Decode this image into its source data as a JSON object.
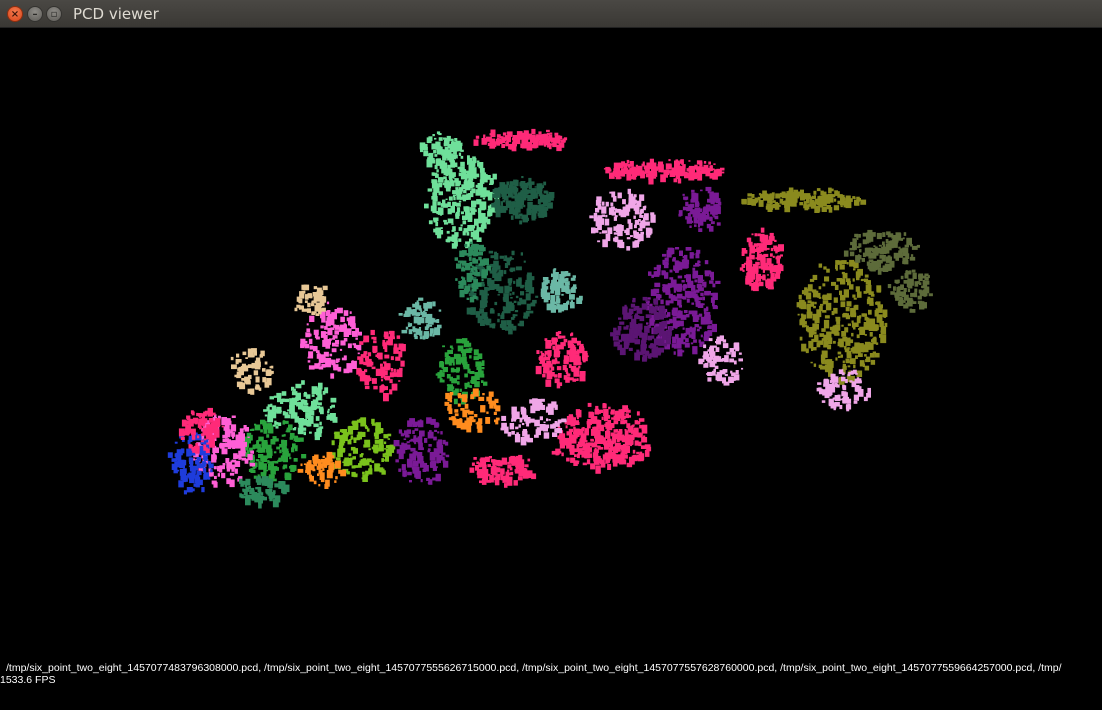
{
  "window": {
    "title": "PCD viewer",
    "close_glyph": "×",
    "minimize_glyph": "–",
    "maximize_glyph": "▫"
  },
  "viewer": {
    "loaded_files": "/tmp/six_point_two_eight_1457077483796308000.pcd, /tmp/six_point_two_eight_1457077555626715000.pcd, /tmp/six_point_two_eight_1457077557628760000.pcd, /tmp/six_point_two_eight_1457077559664257000.pcd, /tmp/",
    "fps_label": "1533.6 FPS",
    "background_color": "#000000",
    "cluster_colors": [
      "#6fe09a",
      "#1f5e46",
      "#2c8a5c",
      "#7a1a96",
      "#5b1573",
      "#ff2a78",
      "#f0a6e8",
      "#8a8a1e",
      "#5d6b3a",
      "#e8c896",
      "#ff5fd6",
      "#29a33c",
      "#7ac21c",
      "#1e3cdc",
      "#ff8c1e",
      "#6bb8a6"
    ]
  }
}
